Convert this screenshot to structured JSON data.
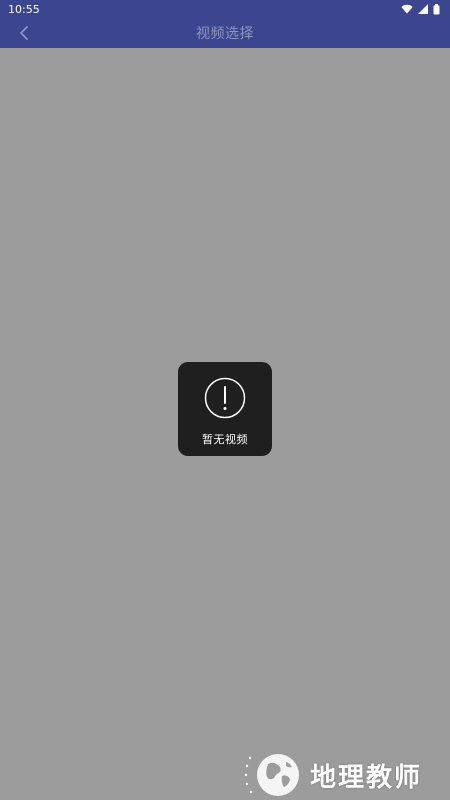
{
  "status_bar": {
    "time": "10:55",
    "icons": [
      "wifi-icon",
      "signal-icon",
      "battery-icon"
    ]
  },
  "header": {
    "title": "视频选择",
    "back_icon": "chevron-left-icon"
  },
  "toast": {
    "icon": "exclamation-circle-icon",
    "message": "暂无视频"
  },
  "watermark": {
    "text": "地理教师",
    "icon": "globe-icon"
  },
  "colors": {
    "app_bar": "#3b4590",
    "background": "#9c9c9c",
    "toast_bg": "#1f1f1f",
    "title_text": "#8f95bd"
  }
}
